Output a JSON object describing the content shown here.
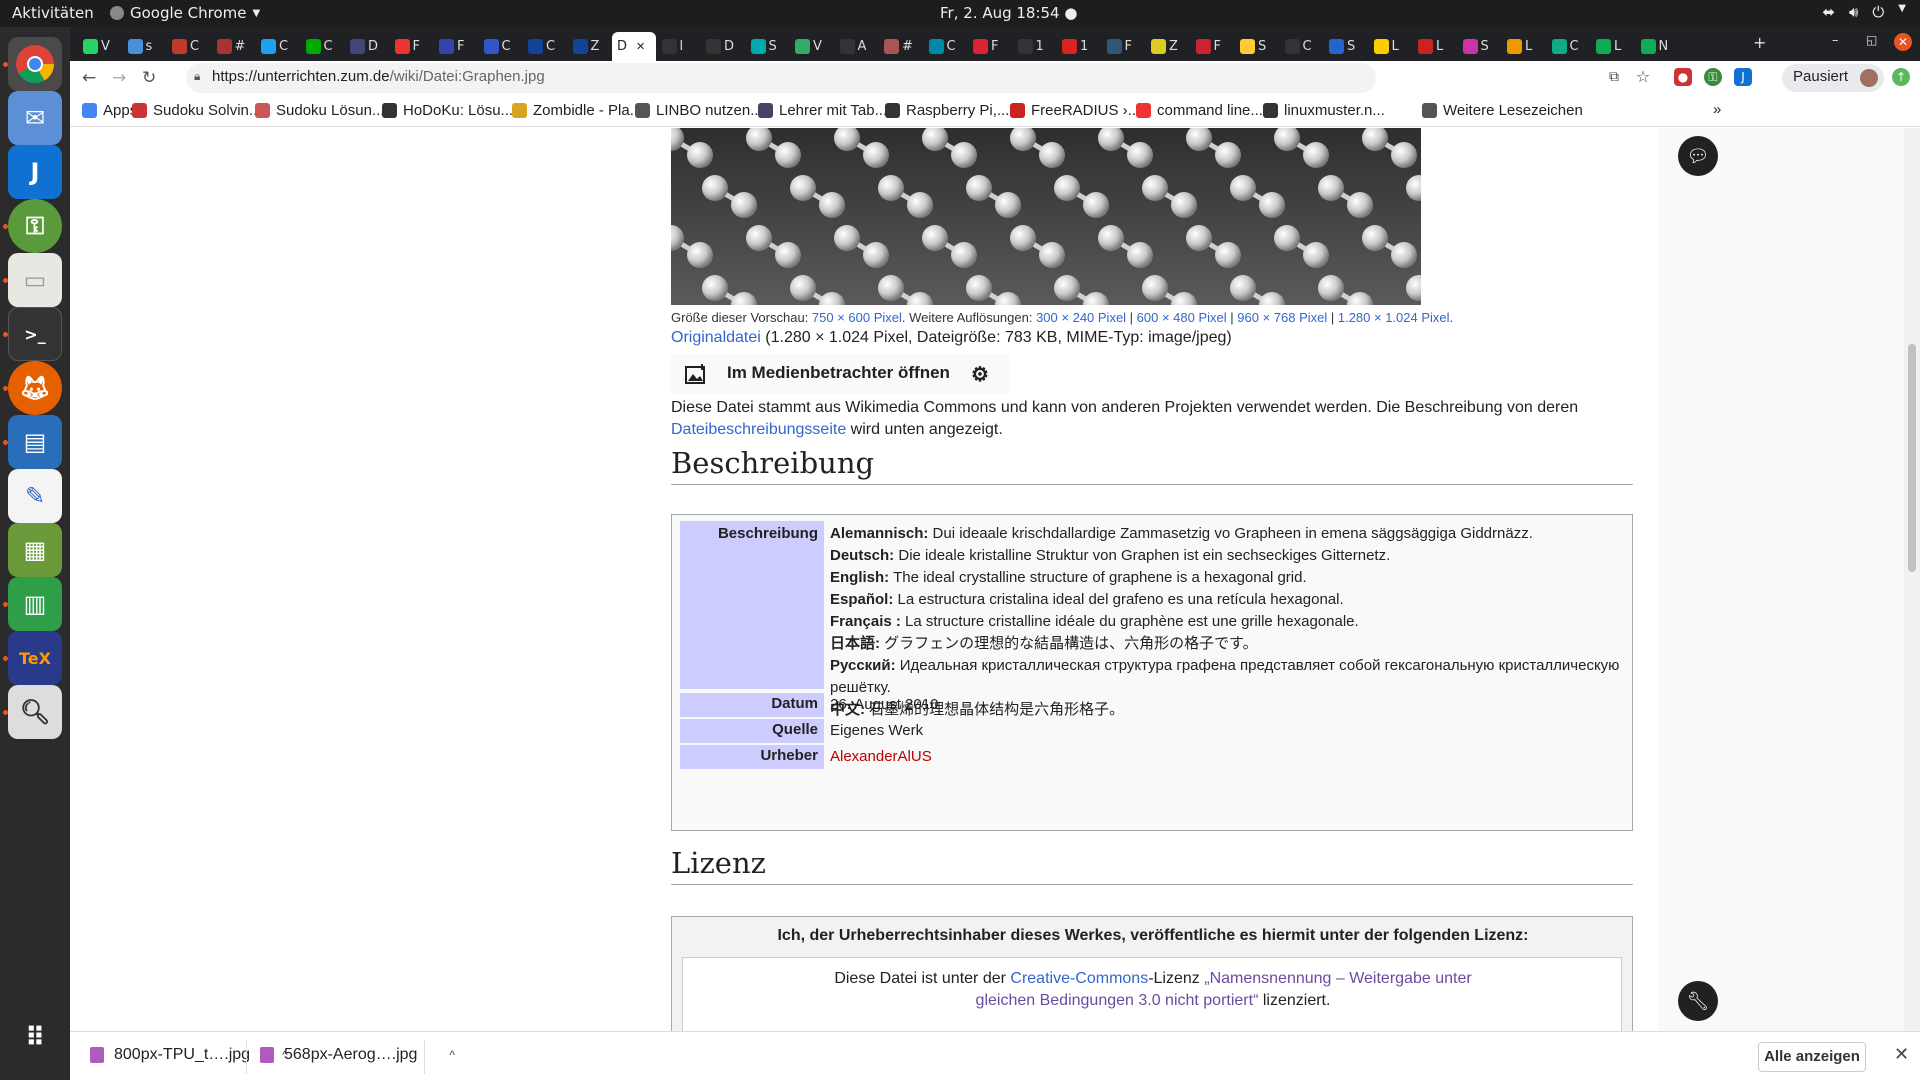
{
  "system": {
    "activities": "Aktivitäten",
    "app_name": "Google Chrome",
    "clock": "Fr, 2. Aug  18:54"
  },
  "tabs": [
    {
      "letter": "V",
      "color": "#25d366"
    },
    {
      "letter": "s",
      "color": "#4a90d9"
    },
    {
      "letter": "C",
      "color": "#c0392b"
    },
    {
      "letter": "#",
      "color": "#a33"
    },
    {
      "letter": "C",
      "color": "#1da1f2"
    },
    {
      "letter": "C",
      "color": "#0a0"
    },
    {
      "letter": "D",
      "color": "#447"
    },
    {
      "letter": "F",
      "color": "#e33"
    },
    {
      "letter": "F",
      "color": "#34a"
    },
    {
      "letter": "C",
      "color": "#35c"
    },
    {
      "letter": "C",
      "color": "#149"
    },
    {
      "letter": "Z",
      "color": "#149"
    },
    {
      "letter": "D",
      "color": "#fff",
      "active": true
    },
    {
      "letter": "l",
      "color": "#333"
    },
    {
      "letter": "D",
      "color": "#333"
    },
    {
      "letter": "S",
      "color": "#0aa"
    },
    {
      "letter": "V",
      "color": "#3a6"
    },
    {
      "letter": "A",
      "color": "#333"
    },
    {
      "letter": "#",
      "color": "#a55"
    },
    {
      "letter": "C",
      "color": "#08a"
    },
    {
      "letter": "F",
      "color": "#d23"
    },
    {
      "letter": "1",
      "color": "#333"
    },
    {
      "letter": "1",
      "color": "#d22"
    },
    {
      "letter": "F",
      "color": "#357"
    },
    {
      "letter": "Z",
      "color": "#dc2"
    },
    {
      "letter": "F",
      "color": "#c23"
    },
    {
      "letter": "S",
      "color": "#fc3"
    },
    {
      "letter": "C",
      "color": "#333"
    },
    {
      "letter": "S",
      "color": "#26c"
    },
    {
      "letter": "L",
      "color": "#fc0"
    },
    {
      "letter": "L",
      "color": "#c22"
    },
    {
      "letter": "S",
      "color": "#c3a"
    },
    {
      "letter": "L",
      "color": "#e90"
    },
    {
      "letter": "C",
      "color": "#1a8"
    },
    {
      "letter": "L",
      "color": "#1a5"
    },
    {
      "letter": "N",
      "color": "#1a5"
    }
  ],
  "toolbar": {
    "url_host": "https://unterrichten.zum.de",
    "url_path": "/wiki/Datei:Graphen.jpg",
    "profile_label": "Pausiert"
  },
  "bookmarks": [
    {
      "label": "Apps",
      "color": "#4285f4"
    },
    {
      "label": "Sudoku Solvin...",
      "color": "#c33"
    },
    {
      "label": "Sudoku Lösun...",
      "color": "#c55"
    },
    {
      "label": "HoDoKu: Lösu...",
      "color": "#333"
    },
    {
      "label": "Zombidle - Pla...",
      "color": "#d9a520"
    },
    {
      "label": "LINBO nutzen...",
      "color": "#555"
    },
    {
      "label": "Lehrer mit Tab...",
      "color": "#446"
    },
    {
      "label": "Raspberry Pi,...",
      "color": "#333"
    },
    {
      "label": "FreeRADIUS ›...",
      "color": "#c22"
    },
    {
      "label": "command line...",
      "color": "#e33"
    },
    {
      "label": "linuxmuster.n...",
      "color": "#333"
    },
    {
      "label": "Weitere Lesezeichen",
      "color": "#555"
    }
  ],
  "file_page": {
    "preview_prefix": "Größe dieser Vorschau: ",
    "preview_main": "750 × 600 Pixel",
    "preview_more": ". Weitere Auflösungen: ",
    "res1": "300 × 240 Pixel",
    "res2": "600 × 480 Pixel",
    "res3": "960 × 768 Pixel",
    "res4": "1.280 × 1.024 Pixel",
    "sep": " | ",
    "dot": ".",
    "original_link": "Originaldatei",
    "original_info": " (1.280 × 1.024 Pixel, Dateigröße: 783 KB, MIME-Typ: image/jpeg)",
    "media_button": "Im Medienbetrachter öffnen",
    "commons_text": "Diese Datei stammt aus Wikimedia Commons und kann von anderen Projekten verwendet werden. Die Beschreibung von deren ",
    "commons_link": "Dateibeschreibungsseite",
    "commons_tail": " wird unten angezeigt."
  },
  "beschreibung": {
    "heading": "Beschreibung",
    "label_desc": "Beschreibung",
    "lines": [
      {
        "lang": "Alemannisch:",
        "text": " Dui ideaale krischdallardige Zammasetzig vo Grapheen in emena säggsäggiga Giddrnäzz."
      },
      {
        "lang": "Deutsch:",
        "text": " Die ideale kristalline Struktur von Graphen ist ein sechseckiges Gitternetz."
      },
      {
        "lang": "English:",
        "text": " The ideal crystalline structure of graphene is a hexagonal grid."
      },
      {
        "lang": "Español:",
        "text": " La estructura cristalina ideal del grafeno es una retícula hexagonal."
      },
      {
        "lang": "Français :",
        "text": " La structure cristalline idéale du graphène est une grille hexagonale."
      },
      {
        "lang": "日本語:",
        "text": " グラフェンの理想的な結晶構造は、六角形の格子です。"
      },
      {
        "lang": "Русский:",
        "text": " Идеальная кристаллическая структура графена представляет собой гексагональную кристаллическую решётку."
      },
      {
        "lang": "中文:",
        "text": " 石墨烯的理想晶体结构是六角形格子。"
      }
    ],
    "label_datum": "Datum",
    "datum": "26. August 2010",
    "label_quelle": "Quelle",
    "quelle": "Eigenes Werk",
    "label_urheber": "Urheber",
    "urheber": "AlexanderAlUS"
  },
  "lizenz": {
    "heading": "Lizenz",
    "title": "Ich, der Urheberrechtsinhaber dieses Werkes, veröffentliche es hiermit unter der folgenden Lizenz:",
    "text1": "Diese Datei ist unter der ",
    "cc_link": "Creative-Commons",
    "text2": "-Lizenz ",
    "license_link": "„Namensnennung – Weitergabe unter gleichen Bedingungen 3.0 nicht portiert“",
    "text3": " lizenziert."
  },
  "downloads": {
    "file1": "800px-TPU_t….jpg",
    "file2": "568px-Aerog….jpg",
    "show_all": "Alle anzeigen"
  }
}
